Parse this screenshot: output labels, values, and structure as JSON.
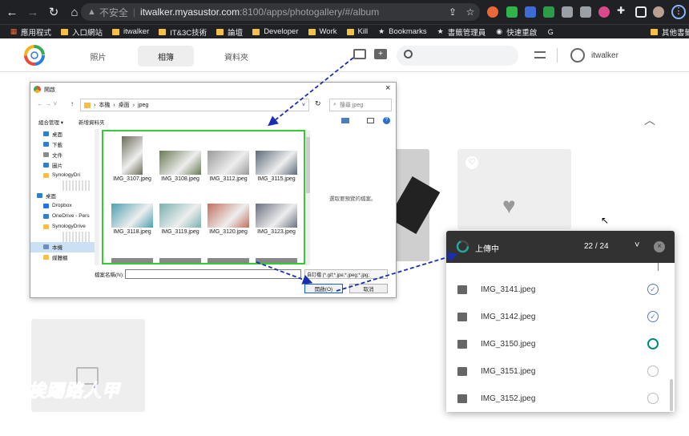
{
  "browser": {
    "omnibox": {
      "security": "不安全",
      "host": "itwalker.myasustor.com",
      "path": ":8100/apps/photogallery/#/album"
    },
    "bookmarks": [
      {
        "label": "應用程式",
        "icon": "apps-grid-icon"
      },
      {
        "label": "入口網站",
        "icon": "folder-icon"
      },
      {
        "label": "itwalker",
        "icon": "folder-icon"
      },
      {
        "label": "IT&3C技術",
        "icon": "folder-icon"
      },
      {
        "label": "論壇",
        "icon": "folder-icon"
      },
      {
        "label": "Developer",
        "icon": "folder-icon"
      },
      {
        "label": "Work",
        "icon": "folder-icon"
      },
      {
        "label": "Kill",
        "icon": "folder-icon"
      },
      {
        "label": "Bookmarks",
        "icon": "star-icon"
      },
      {
        "label": "書籤管理員",
        "icon": "star-icon"
      },
      {
        "label": "快速重啟",
        "icon": "globe-icon"
      },
      {
        "label": "",
        "icon": "google-icon"
      }
    ],
    "other_bookmarks": "其他書籤"
  },
  "app": {
    "tabs": [
      {
        "label": "照片"
      },
      {
        "label": "相簿"
      },
      {
        "label": "資料夾"
      }
    ],
    "active_tab": "相簿",
    "username": "itwalker"
  },
  "dialog": {
    "title": "開啟",
    "breadcrumb": [
      "本機",
      "桌面",
      "jpeg"
    ],
    "search_placeholder": "搜尋 jpeg",
    "toolbar": {
      "organize": "組合管理 ▾",
      "new_folder": "新增資料夾"
    },
    "tree": [
      {
        "label": "桌面",
        "color": "#2f7fd1"
      },
      {
        "label": "下載",
        "color": "#2f7fd1"
      },
      {
        "label": "文件",
        "color": "#8a8a8a"
      },
      {
        "label": "圖片",
        "color": "#2f7fd1"
      },
      {
        "label": "SynologyDri",
        "color": "#f4c04a"
      },
      {
        "label": "",
        "color": ""
      },
      {
        "label": "桌面",
        "color": "#2f7fd1"
      },
      {
        "label": "Dropbox",
        "color": "#1e74e8"
      },
      {
        "label": "OneDrive - Pers",
        "color": "#2f7fd1"
      },
      {
        "label": "SynologyDrive",
        "color": "#f4c04a"
      },
      {
        "label": "",
        "color": ""
      },
      {
        "label": "本機",
        "color": "#6c8ebf"
      },
      {
        "label": "媒體櫃",
        "color": "#f4c04a"
      }
    ],
    "files": [
      {
        "name": "IMG_3107.jpeg",
        "color": "#6b6b5a"
      },
      {
        "name": "IMG_3108.jpeg",
        "color": "#6a7a55"
      },
      {
        "name": "IMG_3112.jpeg",
        "color": "#9a9a9a"
      },
      {
        "name": "IMG_3115.jpeg",
        "color": "#5c6a78"
      },
      {
        "name": "IMG_3118.jpeg",
        "color": "#4aa0b0"
      },
      {
        "name": "IMG_3119.jpeg",
        "color": "#7ab0b0"
      },
      {
        "name": "IMG_3120.jpeg",
        "color": "#c07060"
      },
      {
        "name": "IMG_3123.jpeg",
        "color": "#6a7080"
      }
    ],
    "preview_hint": "選取要預覽的檔案。",
    "filename_label": "檔案名稱(N):",
    "filetype": "自訂檔 (*.gif;*.jpe;*.jpeg;*.jpg;",
    "open_button": "開啟(O)",
    "cancel_button": "取消"
  },
  "upload": {
    "title": "上傳中",
    "progress": "22 / 24",
    "items": [
      {
        "name": "IMG_3141.jpeg",
        "status": "done"
      },
      {
        "name": "IMG_3142.jpeg",
        "status": "done"
      },
      {
        "name": "IMG_3150.jpeg",
        "status": "uploading"
      },
      {
        "name": "IMG_3151.jpeg",
        "status": "pending"
      },
      {
        "name": "IMG_3152.jpeg",
        "status": "pending"
      }
    ]
  },
  "watermark": "挨踢路人甲",
  "colors": {
    "accent": "#00897b",
    "done": "#5c7cba",
    "highlight": "#32cd32",
    "arrow": "#1a2fb0"
  }
}
